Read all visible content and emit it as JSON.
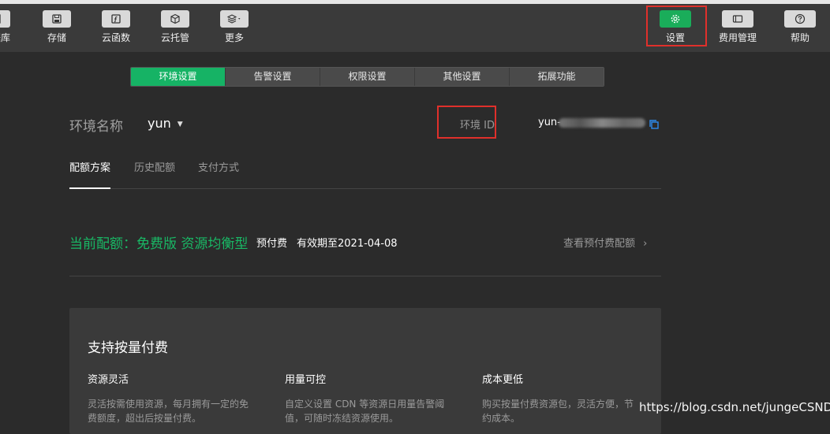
{
  "toolbar": {
    "items": [
      {
        "label": "数据库",
        "icon": "database-icon"
      },
      {
        "label": "存储",
        "icon": "save-icon"
      },
      {
        "label": "云函数",
        "icon": "function-icon"
      },
      {
        "label": "云托管",
        "icon": "cube-icon"
      },
      {
        "label": "更多",
        "icon": "layers-icon"
      }
    ],
    "right_items": [
      {
        "label": "设置",
        "icon": "gear-icon"
      },
      {
        "label": "费用管理",
        "icon": "billing-icon"
      },
      {
        "label": "帮助",
        "icon": "help-icon"
      }
    ]
  },
  "tabs": [
    "环境设置",
    "告警设置",
    "权限设置",
    "其他设置",
    "拓展功能"
  ],
  "env": {
    "name_label": "环境名称",
    "name_value": "yun",
    "id_label": "环境 ID",
    "id_value": "yun-"
  },
  "subtabs": [
    "配额方案",
    "历史配额",
    "支付方式"
  ],
  "quota": {
    "title": "当前配额：免费版 资源均衡型",
    "tag": "预付费",
    "expiry": "有效期至2021-04-08",
    "link": "查看预付费配额"
  },
  "card": {
    "title": "支持按量付费",
    "features": [
      {
        "title": "资源灵活",
        "desc": "灵活按需使用资源，每月拥有一定的免费额度，超出后按量付费。"
      },
      {
        "title": "用量可控",
        "desc": "自定义设置 CDN 等资源日用量告警阈值，可随时冻结资源使用。"
      },
      {
        "title": "成本更低",
        "desc": "购买按量付费资源包，灵活方便，节约成本。"
      }
    ]
  },
  "watermark": "https://blog.csdn.net/jungeCSND",
  "colors": {
    "accent": "#16b365",
    "highlight": "#e0302b",
    "background": "#2b2b2b"
  }
}
